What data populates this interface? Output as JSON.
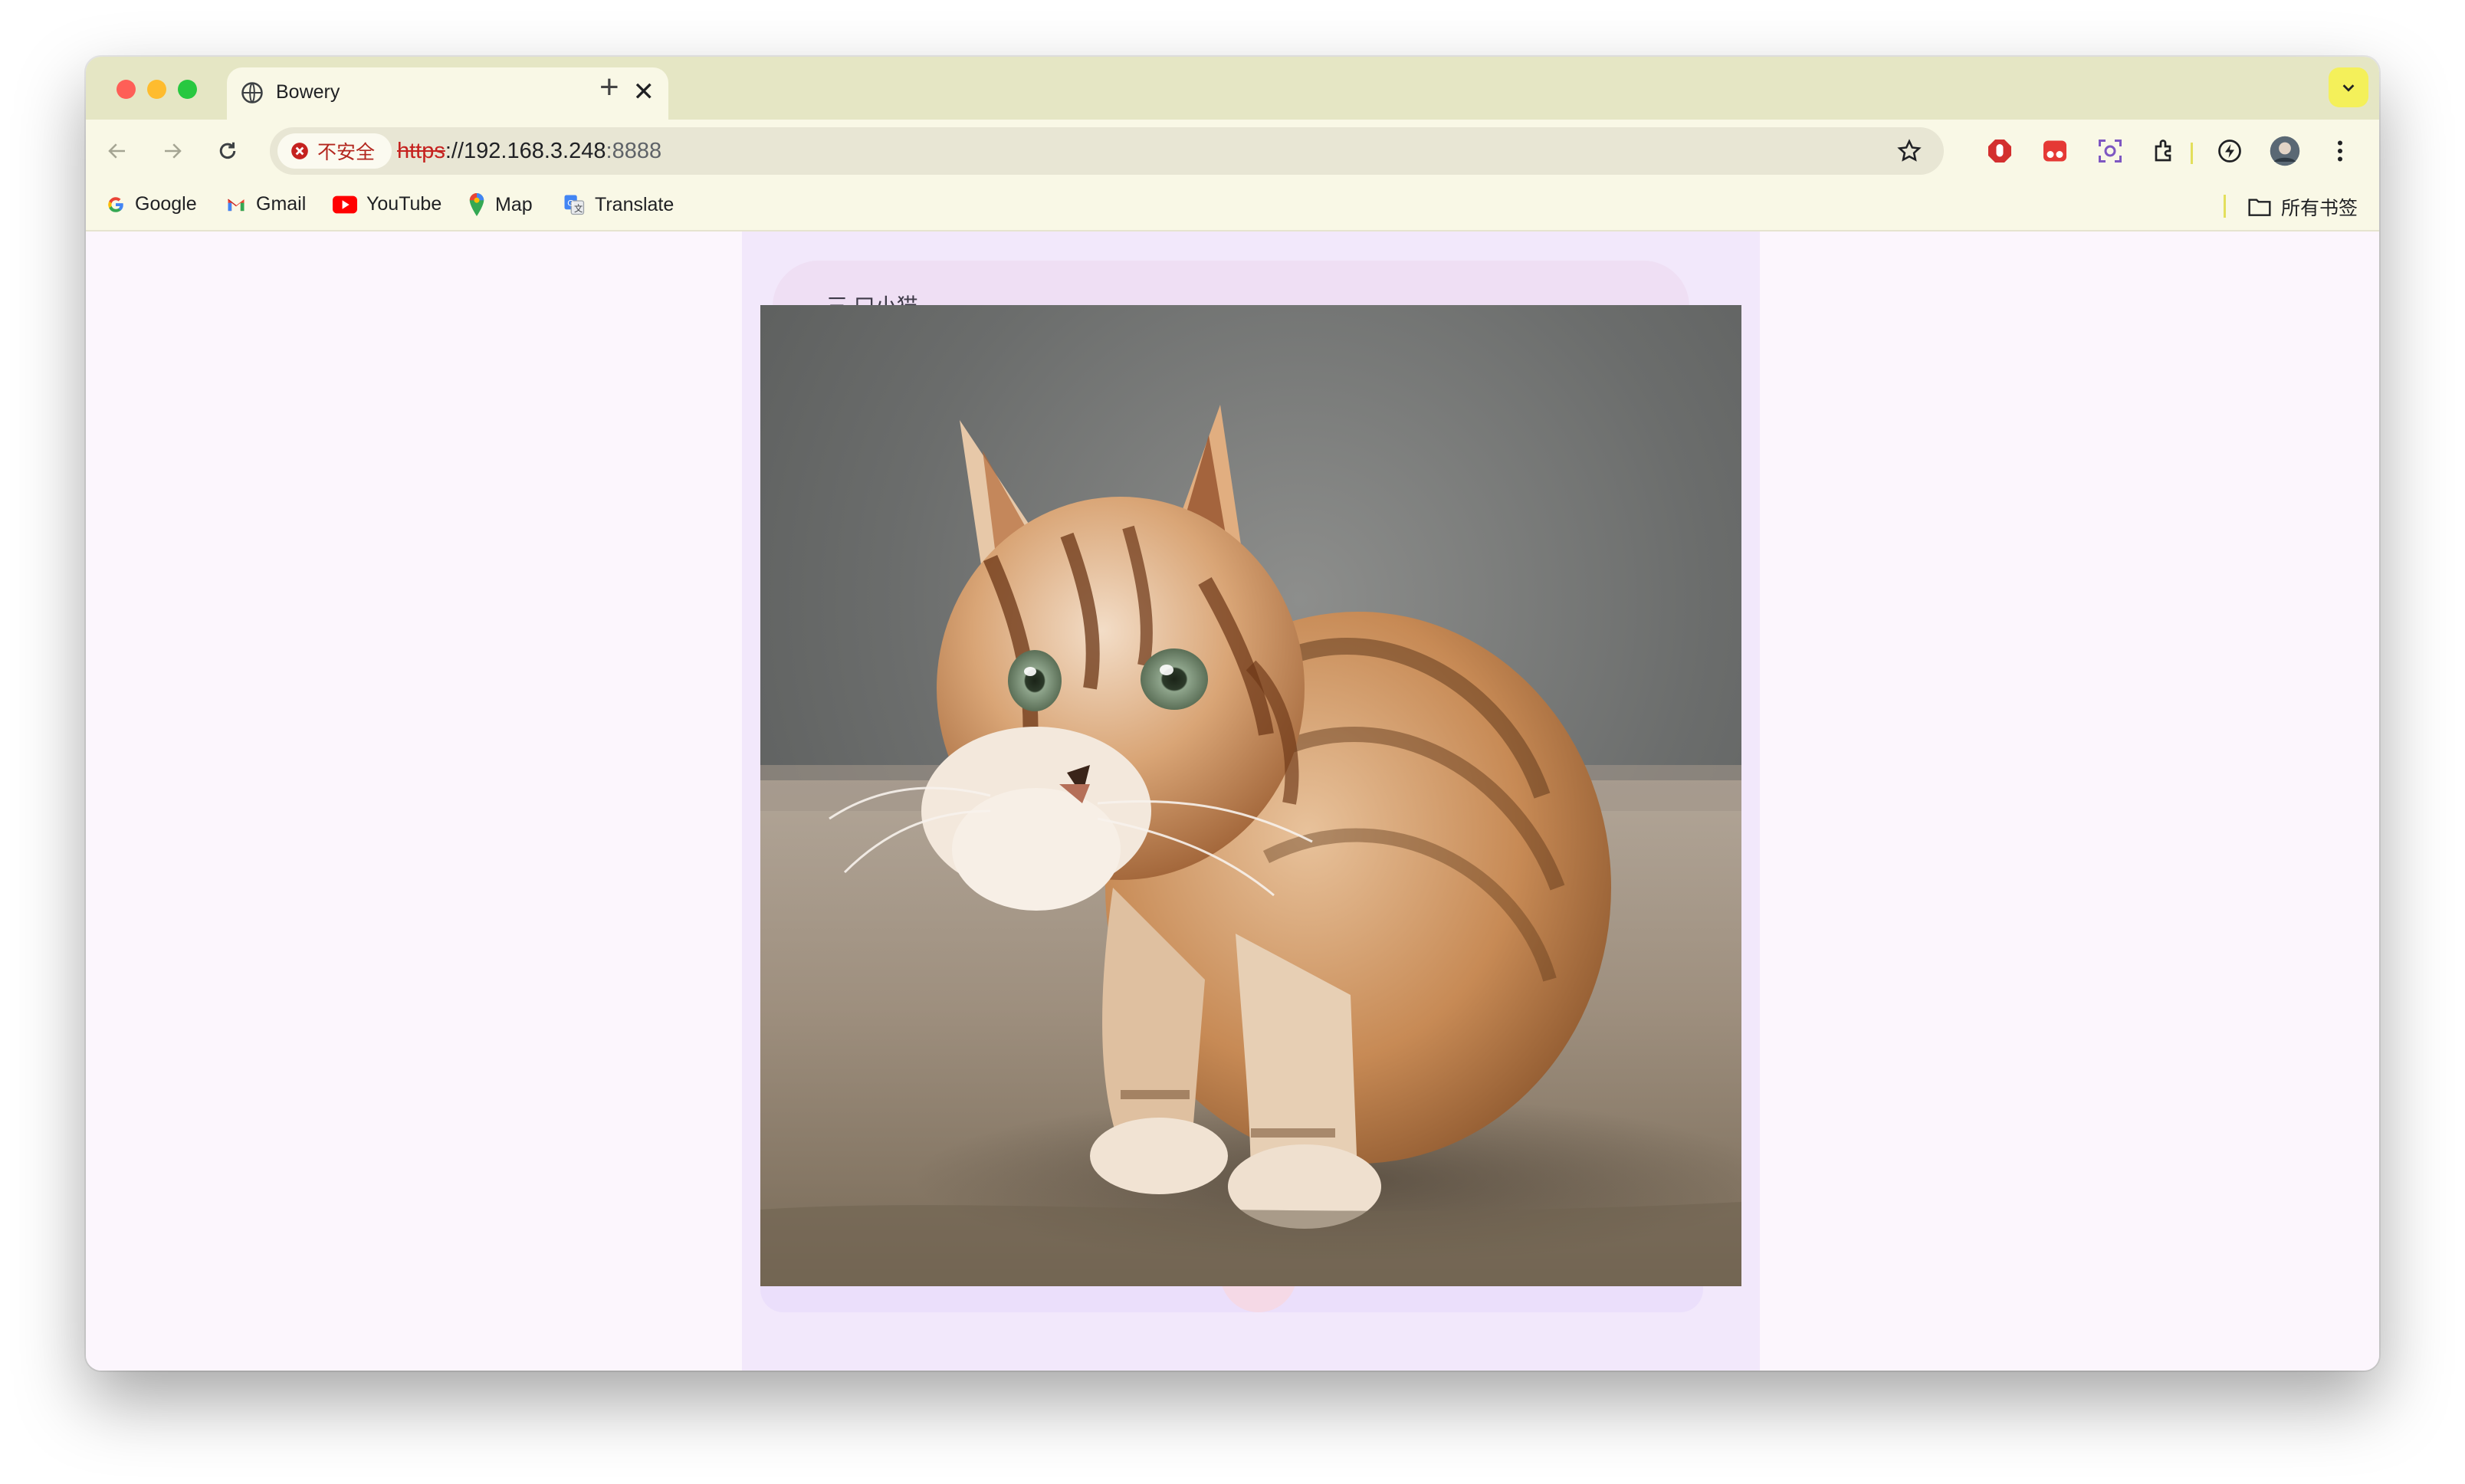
{
  "window": {
    "tab_title": "Bowery",
    "close_symbol": "✕",
    "new_tab_symbol": "+"
  },
  "toolbar": {
    "security_label": "不安全",
    "url_scheme": "https",
    "url_host": "://192.168.3.248",
    "url_port": ":8888"
  },
  "bookmarks": [
    {
      "label": "Google",
      "icon": "google-icon"
    },
    {
      "label": "Gmail",
      "icon": "gmail-icon"
    },
    {
      "label": "YouTube",
      "icon": "youtube-icon"
    },
    {
      "label": "Map",
      "icon": "map-pin-icon"
    },
    {
      "label": "Translate",
      "icon": "translate-icon"
    }
  ],
  "bookmarks_all": "所有书签",
  "app": {
    "header_text": "三  口小猫"
  },
  "colors": {
    "tab_strip": "#e5e6c4",
    "toolbar": "#f9f8e6",
    "page_bg": "#fcf6fd",
    "app_bg": "#f2e8fb",
    "insecure": "#c5221f"
  }
}
